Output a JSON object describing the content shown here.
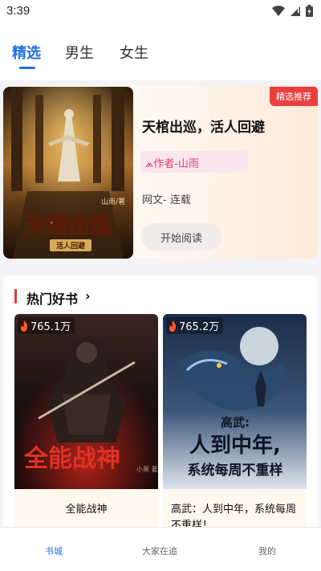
{
  "status_bar": {
    "time": "3:39"
  },
  "top_tabs": [
    {
      "label": "精选",
      "active": true
    },
    {
      "label": "男生",
      "active": false
    },
    {
      "label": "女生",
      "active": false
    }
  ],
  "featured": {
    "badge": "精选推荐",
    "title": "天棺出巡，活人回避",
    "author": "⩕作者-山雨",
    "meta": "网文- 连载",
    "button": "开始阅读",
    "cover_title": "天棺出巡",
    "cover_subtitle": "活人回避",
    "cover_author": "山雨/著"
  },
  "hot_books": {
    "title": "热门好书",
    "arrow": "›",
    "books": [
      {
        "heat": "765.1万",
        "name": "全能战神",
        "cover_text": "全能战神",
        "cover_author": "小黑 著"
      },
      {
        "heat": "765.2万",
        "name": "高武：人到中年，系统每周不重样！",
        "cover_text_1": "高武:",
        "cover_text_2": "人到中年,",
        "cover_text_3": "系统每周不重样"
      }
    ]
  },
  "bottom_nav": [
    {
      "label": "书城",
      "active": true
    },
    {
      "label": "大家在追",
      "active": false
    },
    {
      "label": "我的",
      "active": false
    }
  ],
  "colors": {
    "accent": "#1f6fe5",
    "badge": "#ea3f3f",
    "author": "#e0406a"
  }
}
